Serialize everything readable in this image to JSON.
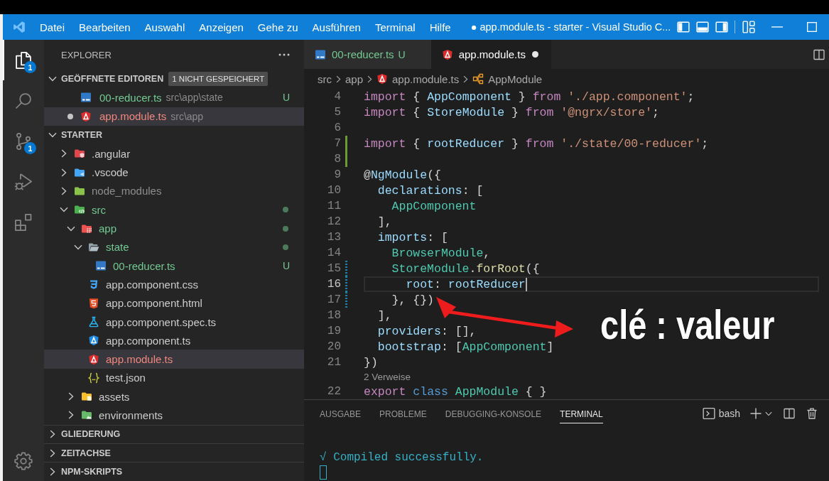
{
  "title_bar": {
    "menu": [
      "Datei",
      "Bearbeiten",
      "Auswahl",
      "Anzeigen",
      "Gehe zu",
      "Ausführen",
      "Terminal",
      "Hilfe"
    ],
    "title": "● app.module.ts - starter - Visual Studio C..."
  },
  "activity_bar": {
    "items": [
      {
        "kind": "explorer",
        "selected": true,
        "badge": "1"
      },
      {
        "kind": "search",
        "selected": false
      },
      {
        "kind": "source-control",
        "selected": false,
        "badge": "1"
      },
      {
        "kind": "run-debug",
        "selected": false
      },
      {
        "kind": "extensions",
        "selected": false
      }
    ],
    "bottom": [
      {
        "kind": "settings"
      }
    ]
  },
  "explorer": {
    "title": "EXPLORER",
    "sections": [
      {
        "title": "GEÖFFNETE EDITOREN",
        "expanded": true,
        "badge": "1 NICHT GESPEICHERT",
        "editors": [
          {
            "name": "00-reducer.ts",
            "path": "src\\app\\state",
            "kind": "ts",
            "untracked": true,
            "ignored": false,
            "error": false,
            "git": "U",
            "dirty": false,
            "selected": false
          },
          {
            "name": "app.module.ts",
            "path": "src\\app",
            "kind": "angular-module",
            "untracked": false,
            "ignored": false,
            "error": true,
            "dirty": true,
            "selected": true
          }
        ]
      },
      {
        "title": "STARTER",
        "expanded": true,
        "tree": [
          {
            "name": ".angular",
            "kind": "folder-angular",
            "untracked": false,
            "ignored": false,
            "error": false,
            "expanded": false,
            "selected": false
          },
          {
            "name": ".vscode",
            "kind": "folder-vscode",
            "untracked": false,
            "ignored": false,
            "error": false,
            "expanded": false,
            "selected": false
          },
          {
            "name": "node_modules",
            "kind": "folder-node",
            "untracked": false,
            "ignored": true,
            "error": false,
            "expanded": false,
            "selected": false
          },
          {
            "name": "src",
            "kind": "folder-src",
            "untracked": true,
            "ignored": false,
            "error": false,
            "expanded": true,
            "selected": false,
            "children": [
              {
                "name": "app",
                "kind": "folder-app",
                "untracked": true,
                "ignored": false,
                "error": false,
                "expanded": true,
                "selected": false,
                "children": [
                  {
                    "name": "state",
                    "kind": "folder-open",
                    "untracked": true,
                    "ignored": false,
                    "error": false,
                    "expanded": true,
                    "selected": false,
                    "children": [
                      {
                        "name": "00-reducer.ts",
                        "kind": "ts",
                        "untracked": true,
                        "ignored": false,
                        "error": false,
                        "git": "U",
                        "selected": false
                      }
                    ]
                  },
                  {
                    "name": "app.component.css",
                    "kind": "css",
                    "untracked": false,
                    "ignored": false,
                    "error": false,
                    "selected": false
                  },
                  {
                    "name": "app.component.html",
                    "kind": "html",
                    "untracked": false,
                    "ignored": false,
                    "error": false,
                    "selected": false
                  },
                  {
                    "name": "app.component.spec.ts",
                    "kind": "spec",
                    "untracked": false,
                    "ignored": false,
                    "error": false,
                    "selected": false
                  },
                  {
                    "name": "app.component.ts",
                    "kind": "angular-component",
                    "untracked": false,
                    "ignored": false,
                    "error": false,
                    "selected": false
                  },
                  {
                    "name": "app.module.ts",
                    "kind": "angular-module",
                    "untracked": false,
                    "ignored": false,
                    "error": true,
                    "selected": true
                  },
                  {
                    "name": "test.json",
                    "kind": "json",
                    "untracked": false,
                    "ignored": false,
                    "error": false,
                    "selected": false
                  }
                ]
              },
              {
                "name": "assets",
                "kind": "folder-assets",
                "untracked": false,
                "ignored": false,
                "error": false,
                "expanded": false,
                "selected": false
              },
              {
                "name": "environments",
                "kind": "folder-environments",
                "untracked": false,
                "ignored": false,
                "error": false,
                "expanded": false,
                "selected": false
              }
            ]
          }
        ]
      },
      {
        "title": "GLIEDERUNG",
        "expanded": false
      },
      {
        "title": "ZEITACHSE",
        "expanded": false
      },
      {
        "title": "NPM-SKRIPTS",
        "expanded": false
      }
    ]
  },
  "editor": {
    "tabs": [
      {
        "name": "00-reducer.ts",
        "kind": "ts",
        "untracked": true,
        "git": "U",
        "dirty": false,
        "selected": false
      },
      {
        "name": "app.module.ts",
        "kind": "angular-module",
        "untracked": false,
        "dirty": true,
        "selected": true
      }
    ],
    "breadcrumbs": [
      {
        "text": "src",
        "kind": "folder"
      },
      {
        "text": "app",
        "kind": "folder"
      },
      {
        "text": "app.module.ts",
        "kind": "angular-module"
      },
      {
        "text": "AppModule",
        "kind": "class"
      }
    ],
    "lines": [
      {
        "kind": "code",
        "number": "4",
        "current": false,
        "added": false,
        "modified": false,
        "tokens": [
          {
            "text": "import",
            "kind": "keyword"
          },
          {
            "text": " { ",
            "kind": "punct"
          },
          {
            "text": "AppComponent",
            "kind": "variable"
          },
          {
            "text": " } ",
            "kind": "punct"
          },
          {
            "text": "from",
            "kind": "keyword"
          },
          {
            "text": " './app.component'",
            "kind": "string"
          },
          {
            "text": ";",
            "kind": "punct"
          }
        ]
      },
      {
        "kind": "code",
        "number": "5",
        "current": false,
        "added": false,
        "modified": false,
        "tokens": [
          {
            "text": "import",
            "kind": "keyword"
          },
          {
            "text": " { ",
            "kind": "punct"
          },
          {
            "text": "StoreModule",
            "kind": "variable"
          },
          {
            "text": " } ",
            "kind": "punct"
          },
          {
            "text": "from",
            "kind": "keyword"
          },
          {
            "text": " '@ngrx/store'",
            "kind": "string"
          },
          {
            "text": ";",
            "kind": "punct"
          }
        ]
      },
      {
        "kind": "code",
        "number": "6",
        "current": false,
        "added": false,
        "modified": false
      },
      {
        "kind": "code",
        "number": "7",
        "current": false,
        "added": true,
        "modified": false,
        "tokens": [
          {
            "text": "import",
            "kind": "keyword"
          },
          {
            "text": " { ",
            "kind": "punct"
          },
          {
            "text": "rootReducer",
            "kind": "variable"
          },
          {
            "text": " } ",
            "kind": "punct"
          },
          {
            "text": "from",
            "kind": "keyword"
          },
          {
            "text": " './state/00-reducer'",
            "kind": "string"
          },
          {
            "text": ";",
            "kind": "punct"
          }
        ]
      },
      {
        "kind": "code",
        "number": "8",
        "current": false,
        "added": true,
        "modified": false
      },
      {
        "kind": "code",
        "number": "9",
        "current": false,
        "added": false,
        "modified": false,
        "tokens": [
          {
            "text": "@",
            "kind": "punct"
          },
          {
            "text": "NgModule",
            "kind": "variable"
          },
          {
            "text": "({",
            "kind": "punct"
          }
        ]
      },
      {
        "kind": "code",
        "number": "10",
        "current": false,
        "added": false,
        "modified": false,
        "tokens": [
          {
            "text": "  declarations",
            "kind": "variable"
          },
          {
            "text": ": [",
            "kind": "punct"
          }
        ]
      },
      {
        "kind": "code",
        "number": "11",
        "current": false,
        "added": false,
        "modified": false,
        "tokens": [
          {
            "text": "    AppComponent",
            "kind": "type"
          }
        ]
      },
      {
        "kind": "code",
        "number": "12",
        "current": false,
        "added": false,
        "modified": false,
        "tokens": [
          {
            "text": "  ],",
            "kind": "punct"
          }
        ]
      },
      {
        "kind": "code",
        "number": "13",
        "current": false,
        "added": false,
        "modified": false,
        "tokens": [
          {
            "text": "  imports",
            "kind": "variable"
          },
          {
            "text": ": [",
            "kind": "punct"
          }
        ]
      },
      {
        "kind": "code",
        "number": "14",
        "current": false,
        "added": false,
        "modified": false,
        "tokens": [
          {
            "text": "    BrowserModule",
            "kind": "type"
          },
          {
            "text": ",",
            "kind": "punct"
          }
        ]
      },
      {
        "kind": "code",
        "number": "15",
        "current": false,
        "added": false,
        "modified": true,
        "tokens": [
          {
            "text": "    StoreModule",
            "kind": "type"
          },
          {
            "text": ".",
            "kind": "punct"
          },
          {
            "text": "forRoot",
            "kind": "function"
          },
          {
            "text": "({",
            "kind": "punct"
          }
        ]
      },
      {
        "kind": "code",
        "number": "16",
        "current": true,
        "added": false,
        "modified": true,
        "tokens": [
          {
            "text": "      root",
            "kind": "variable"
          },
          {
            "text": ": ",
            "kind": "punct"
          },
          {
            "text": "rootReducer",
            "kind": "variable"
          }
        ]
      },
      {
        "kind": "code",
        "number": "17",
        "current": false,
        "added": false,
        "modified": true,
        "tokens": [
          {
            "text": "    }, {})",
            "kind": "punct"
          }
        ]
      },
      {
        "kind": "code",
        "number": "18",
        "current": false,
        "added": false,
        "modified": false,
        "tokens": [
          {
            "text": "  ],",
            "kind": "punct"
          }
        ]
      },
      {
        "kind": "code",
        "number": "19",
        "current": false,
        "added": false,
        "modified": false,
        "tokens": [
          {
            "text": "  providers",
            "kind": "variable"
          },
          {
            "text": ": [],",
            "kind": "punct"
          }
        ]
      },
      {
        "kind": "code",
        "number": "20",
        "current": false,
        "added": false,
        "modified": false,
        "tokens": [
          {
            "text": "  bootstrap",
            "kind": "variable"
          },
          {
            "text": ": [",
            "kind": "punct"
          },
          {
            "text": "AppComponent",
            "kind": "type"
          },
          {
            "text": "]",
            "kind": "punct"
          }
        ]
      },
      {
        "kind": "code",
        "number": "21",
        "current": false,
        "added": false,
        "modified": false,
        "tokens": [
          {
            "text": "})",
            "kind": "punct"
          }
        ]
      },
      {
        "kind": "codelens",
        "text": "2 Verweise"
      },
      {
        "kind": "code",
        "number": "22",
        "current": false,
        "added": false,
        "modified": false,
        "tokens": [
          {
            "text": "export",
            "kind": "keyword"
          },
          {
            "text": " class",
            "kind": "storage"
          },
          {
            "text": " AppModule",
            "kind": "type"
          },
          {
            "text": " { }",
            "kind": "punct"
          }
        ]
      }
    ]
  },
  "panel": {
    "tabs": [
      {
        "label": "AUSGABE",
        "selected": false
      },
      {
        "label": "PROBLEME",
        "selected": false
      },
      {
        "label": "DEBUGGING-KONSOLE",
        "selected": false
      },
      {
        "label": "TERMINAL",
        "selected": true
      }
    ],
    "shell": "bash",
    "terminal_lines": [
      "√ Compiled successfully."
    ]
  },
  "annotation": {
    "text": "clé : valeur"
  }
}
